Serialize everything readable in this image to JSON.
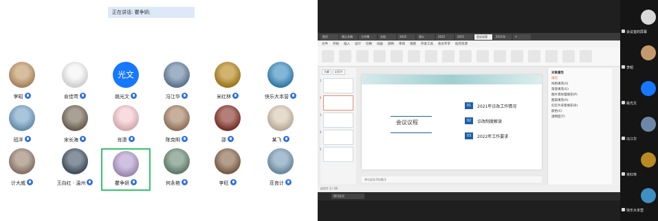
{
  "speaking_banner": "正在讲话: 瞿争妍;",
  "gallery": {
    "participants": [
      {
        "name": "李昭",
        "kind": "photo",
        "color": "#c49a6c"
      },
      {
        "name": "俞佳莺",
        "kind": "cartoon",
        "color": "#f4f4f4"
      },
      {
        "name": "姚光文",
        "kind": "text",
        "text": "光文",
        "color": "#1677ff"
      },
      {
        "name": "冯江华",
        "kind": "photo",
        "color": "#6d88a6"
      },
      {
        "name": "米红林",
        "kind": "photo",
        "color": "#b98a22"
      },
      {
        "name": "快乐大本营",
        "kind": "photo",
        "color": "#3f8fc1"
      },
      {
        "name": "冠洋",
        "kind": "photo",
        "color": "#7aa6c9"
      },
      {
        "name": "宋长海",
        "kind": "photo",
        "color": "#7b6e5e"
      },
      {
        "name": "肖潇",
        "kind": "cartoon",
        "color": "#f6c9cf"
      },
      {
        "name": "陈克明",
        "kind": "photo",
        "color": "#a9866a"
      },
      {
        "name": "邵",
        "kind": "photo",
        "color": "#8a3a2f"
      },
      {
        "name": "某飞",
        "kind": "photo",
        "color": "#d8c9b4"
      },
      {
        "name": "计大威",
        "kind": "photo",
        "color": "#9d8575"
      },
      {
        "name": "王向红 · 温州",
        "kind": "photo",
        "color": "#4b5a6b"
      },
      {
        "name": "瞿争妍",
        "kind": "photo",
        "color": "#b7a0cf"
      },
      {
        "name": "何永艳",
        "kind": "photo",
        "color": "#6f8f7a"
      },
      {
        "name": "李旺",
        "kind": "photo",
        "color": "#8b6b50"
      },
      {
        "name": "荘良计",
        "kind": "photo",
        "color": "#7d9fb8"
      }
    ]
  },
  "share": {
    "tabs": [
      "首页",
      "演示文稿",
      "工作簿",
      "文档",
      "2022",
      "演示",
      "2022",
      "2021",
      "会议议程",
      "2021年",
      "+"
    ],
    "menu": [
      "文件",
      "开始",
      "插入",
      "设计",
      "切换",
      "动画",
      "放映",
      "审阅",
      "视图",
      "开发工具",
      "会员专享",
      "稻壳资源"
    ],
    "thumb_tabs": [
      "大纲",
      "幻灯片"
    ],
    "slide": {
      "title": "会议议程",
      "agenda": [
        {
          "num": "01",
          "text": "2021年诊改工作情况"
        },
        {
          "num": "02",
          "text": "诊改制度解读"
        },
        {
          "num": "03",
          "text": "2022年工作要求"
        }
      ]
    },
    "notes_placeholder": "单击此处添加备注",
    "panel": {
      "title": "对象属性",
      "rows": [
        "填充",
        "纯色填充(S)",
        "渐变填充(G)",
        "图片或纹理填充(P)",
        "图案填充(A)",
        "幻灯片背景填充(B)",
        "颜色(C)",
        "透明度(T)"
      ]
    },
    "status": "幻灯片 2 / 18",
    "taskbar_item": "视讯会议"
  },
  "plist": {
    "items": [
      {
        "label": "会议室的屏幕",
        "color": "#d9d9d9"
      },
      {
        "label": "李昭",
        "color": "#c49a6c"
      },
      {
        "label": "姚光文",
        "color": "#1677ff"
      },
      {
        "label": "冯江华",
        "color": "#6d88a6"
      },
      {
        "label": "米红林",
        "color": "#b98a22"
      },
      {
        "label": "快乐大本营",
        "color": "#3f8fc1"
      }
    ]
  }
}
